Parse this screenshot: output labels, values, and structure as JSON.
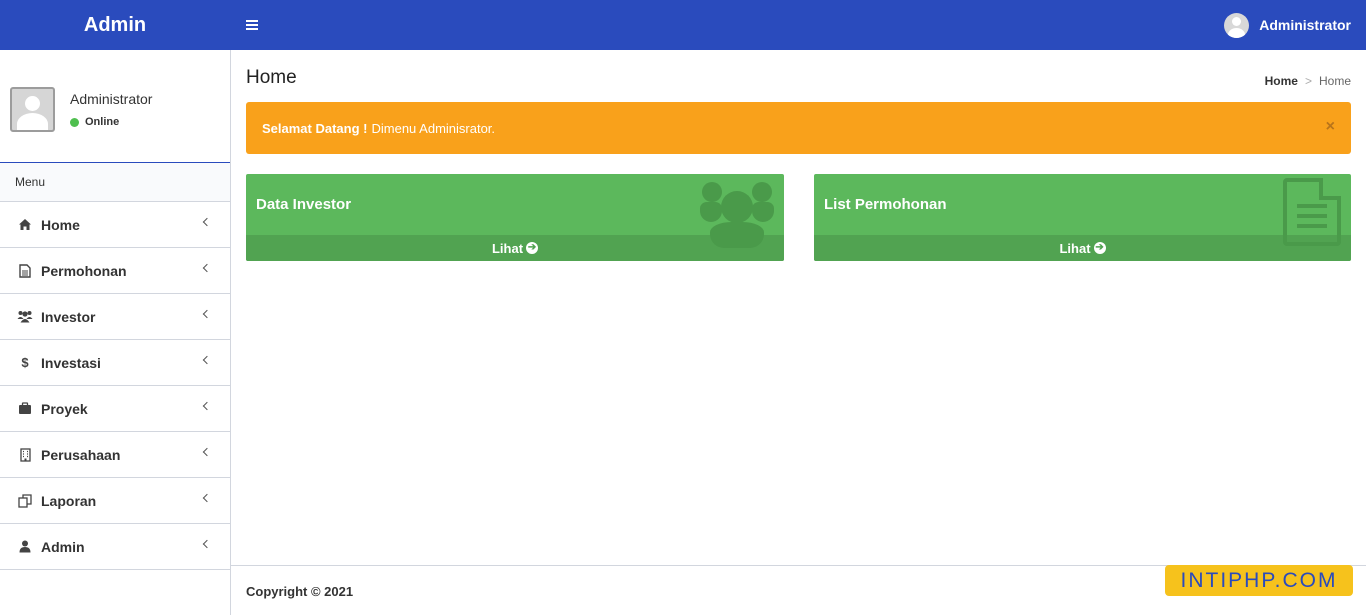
{
  "header": {
    "brand": "Admin",
    "user_name": "Administrator"
  },
  "sidebar": {
    "user_name": "Administrator",
    "user_status": "Online",
    "menu_header": "Menu",
    "items": [
      {
        "label": "Home",
        "icon": "home-icon"
      },
      {
        "label": "Permohonan",
        "icon": "file-icon"
      },
      {
        "label": "Investor",
        "icon": "users-icon"
      },
      {
        "label": "Investasi",
        "icon": "dollar-icon"
      },
      {
        "label": "Proyek",
        "icon": "briefcase-icon"
      },
      {
        "label": "Perusahaan",
        "icon": "building-icon"
      },
      {
        "label": "Laporan",
        "icon": "copy-icon"
      },
      {
        "label": "Admin",
        "icon": "user-icon"
      }
    ]
  },
  "content": {
    "page_title": "Home",
    "breadcrumb": {
      "home": "Home",
      "separator": ">",
      "current": "Home"
    },
    "alert": {
      "strong": "Selamat Datang !",
      "text": "Dimenu Adminisrator.",
      "close": "×"
    },
    "boxes": [
      {
        "title": "Data Investor",
        "link": "Lihat"
      },
      {
        "title": "List Permohonan",
        "link": "Lihat"
      }
    ]
  },
  "footer": {
    "copyright": "Copyright © 2021"
  },
  "watermark": "INTIPHP.COM",
  "colors": {
    "topbar": "#2a4bbd",
    "alert": "#f9a11b",
    "box": "#5cb85c",
    "box_footer": "#51a351"
  }
}
